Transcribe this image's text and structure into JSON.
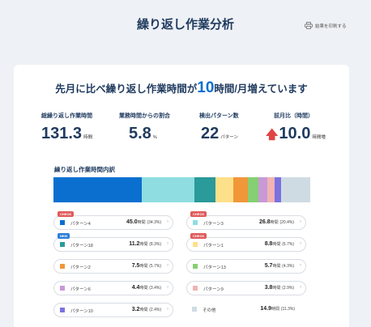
{
  "header": {
    "title": "繰り返し作業分析",
    "print_label": "結果を印刷する"
  },
  "headline": {
    "prefix": "先月に比べ繰り返し作業時間が",
    "value": "10",
    "suffix": "時間/月増えています"
  },
  "stats": [
    {
      "label": "総繰り返し作業時間",
      "value": "131.3",
      "unit": "時間"
    },
    {
      "label": "業務時間からの割合",
      "value": "5.8",
      "unit": "%"
    },
    {
      "label": "検出パターン数",
      "value": "22",
      "unit": "パターン"
    },
    {
      "label": "前月比（時間）",
      "value": "10.0",
      "unit": "時間増",
      "arrow": "🡅"
    }
  ],
  "breakdown": {
    "title": "繰り返し作業時間内訳",
    "chevron": "›",
    "bar": [
      {
        "name": "パターン4",
        "percent": 34.3,
        "color": "#0a6fcf"
      },
      {
        "name": "パターン3",
        "percent": 20.4,
        "color": "#8fdde0"
      },
      {
        "name": "パターン18",
        "percent": 8.3,
        "color": "#2a9a9a"
      },
      {
        "name": "パターン1",
        "percent": 6.7,
        "color": "#fde08a"
      },
      {
        "name": "パターン2",
        "percent": 5.7,
        "color": "#f0973a"
      },
      {
        "name": "パターン13",
        "percent": 4.3,
        "color": "#86cf73"
      },
      {
        "name": "パターン6",
        "percent": 3.4,
        "color": "#c899d6"
      },
      {
        "name": "パターン9",
        "percent": 2.9,
        "color": "#f2b3b3"
      },
      {
        "name": "パターン10",
        "percent": 2.4,
        "color": "#7b72e0"
      },
      {
        "name": "その他",
        "percent": 11.3,
        "color": "#cfdbe3"
      }
    ],
    "items": [
      {
        "badge": "CHECK",
        "badge_type": "check",
        "name": "パターン4",
        "value": "45.0",
        "unit": "時間",
        "pct": "(34.3%)",
        "color": "#0a6fcf"
      },
      {
        "badge": "CHECK",
        "badge_type": "check",
        "name": "パターン3",
        "value": "26.8",
        "unit": "時間",
        "pct": "(20.4%)",
        "color": "#8fdde0"
      },
      {
        "badge": "NEW",
        "badge_type": "new",
        "name": "パターン18",
        "value": "11.2",
        "unit": "時間",
        "pct": "(8.3%)",
        "color": "#2a9a9a"
      },
      {
        "badge": "CHECK",
        "badge_type": "check",
        "name": "パターン1",
        "value": "8.8",
        "unit": "時間",
        "pct": "(6.7%)",
        "color": "#fde08a"
      },
      {
        "badge": "",
        "badge_type": "",
        "name": "パターン2",
        "value": "7.5",
        "unit": "時間",
        "pct": "(5.7%)",
        "color": "#f0973a"
      },
      {
        "badge": "",
        "badge_type": "",
        "name": "パターン13",
        "value": "5.7",
        "unit": "時間",
        "pct": "(4.3%)",
        "color": "#86cf73"
      },
      {
        "badge": "",
        "badge_type": "",
        "name": "パターン6",
        "value": "4.4",
        "unit": "時間",
        "pct": "(3.4%)",
        "color": "#c899d6"
      },
      {
        "badge": "",
        "badge_type": "",
        "name": "パターン9",
        "value": "3.8",
        "unit": "時間",
        "pct": "(2.9%)",
        "color": "#f2b3b3"
      },
      {
        "badge": "",
        "badge_type": "",
        "name": "パターン10",
        "value": "3.2",
        "unit": "時間",
        "pct": "(2.4%)",
        "color": "#7b72e0"
      },
      {
        "badge": "",
        "badge_type": "",
        "name": "その他",
        "value": "14.9",
        "unit": "時間",
        "pct": "(11.3%)",
        "color": "#cfdbe3",
        "other": true
      }
    ]
  }
}
